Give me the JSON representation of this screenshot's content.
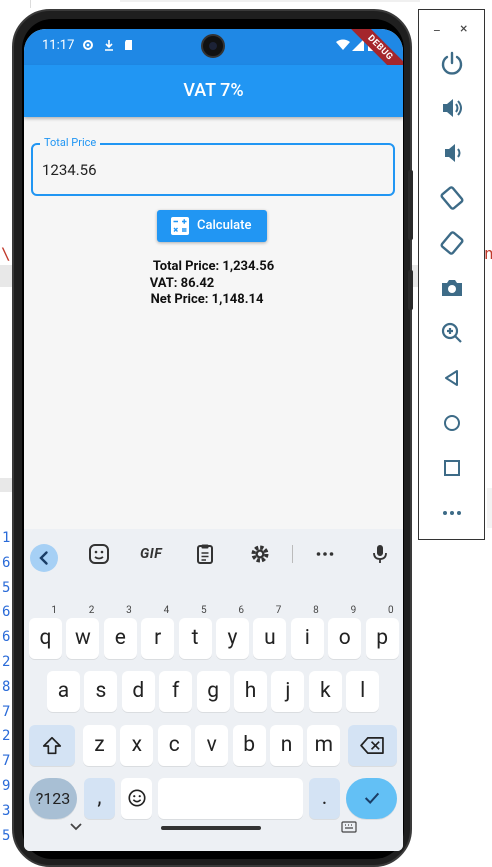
{
  "background": {
    "gutter_numbers": [
      "1",
      "6",
      "5",
      "6",
      "6",
      "2",
      "8",
      "7",
      "2",
      "7",
      "9",
      "3",
      "5"
    ],
    "left_red_char": "\\",
    "right_red_char": "n"
  },
  "device": {
    "status_bar": {
      "time": "11:17",
      "debug_banner": "DEBUG"
    },
    "app_bar": {
      "title": "VAT 7%"
    },
    "form": {
      "total_price_label": "Total Price",
      "total_price_value": "1234.56",
      "calculate_label": "Calculate"
    },
    "results": {
      "total_price": "Total Price: 1,234.56",
      "vat": "VAT: 86.42",
      "net_price": "Net Price: 1,148.14"
    },
    "keyboard": {
      "toolbar": [
        "back",
        "sticker",
        "GIF",
        "clipboard",
        "settings",
        "more",
        "mic"
      ],
      "gif_label": "GIF",
      "row1": [
        {
          "k": "q",
          "h": "1"
        },
        {
          "k": "w",
          "h": "2"
        },
        {
          "k": "e",
          "h": "3"
        },
        {
          "k": "r",
          "h": "4"
        },
        {
          "k": "t",
          "h": "5"
        },
        {
          "k": "y",
          "h": "6"
        },
        {
          "k": "u",
          "h": "7"
        },
        {
          "k": "i",
          "h": "8"
        },
        {
          "k": "o",
          "h": "9"
        },
        {
          "k": "p",
          "h": "0"
        }
      ],
      "row2": [
        "a",
        "s",
        "d",
        "f",
        "g",
        "h",
        "j",
        "k",
        "l"
      ],
      "row3": [
        "z",
        "x",
        "c",
        "v",
        "b",
        "n",
        "m"
      ],
      "symbols_label": "?123",
      "comma_label": ",",
      "period_label": "."
    }
  },
  "emulator_panel": {
    "minimize": "–",
    "close": "×",
    "buttons": [
      "power-icon",
      "volume-up-icon",
      "volume-down-icon",
      "rotate-left-icon",
      "rotate-right-icon",
      "camera-icon",
      "zoom-icon",
      "back-icon",
      "home-icon",
      "overview-icon",
      "more-icon"
    ]
  },
  "colors": {
    "app_bar": "#2196f3",
    "status_bar": "#1f88e5",
    "accent": "#2196f3",
    "debug": "#a4262c"
  }
}
